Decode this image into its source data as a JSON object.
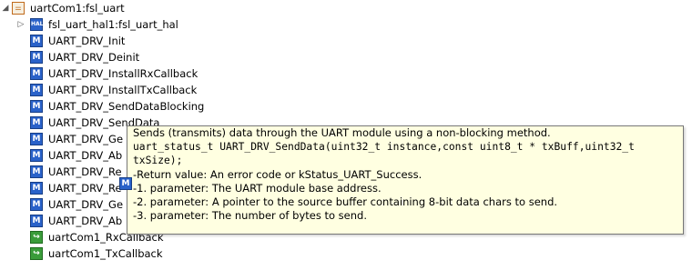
{
  "tree": {
    "root": {
      "label": "uartCom1:fsl_uart",
      "icon": "component-icon",
      "expanded": true
    },
    "hal": {
      "label": "fsl_uart_hal1:fsl_uart_hal",
      "icon": "hal-icon",
      "expanded": false
    },
    "methods": [
      "UART_DRV_Init",
      "UART_DRV_Deinit",
      "UART_DRV_InstallRxCallback",
      "UART_DRV_InstallTxCallback",
      "UART_DRV_SendDataBlocking",
      "UART_DRV_SendData",
      "UART_DRV_Ge",
      "UART_DRV_Ab",
      "UART_DRV_Re",
      "UART_DRV_Re",
      "UART_DRV_Ge",
      "UART_DRV_Ab"
    ],
    "callbacks": [
      "uartCom1_RxCallback",
      "uartCom1_TxCallback"
    ]
  },
  "tooltip": {
    "description": "Sends (transmits) data through the UART module using a non-blocking method.",
    "signature_line1": "uart_status_t UART_DRV_SendData(uint32_t instance,const uint8_t * txBuff,uint32_t",
    "signature_line2": "txSize);",
    "return_value": "-Return value: An error code or kStatus_UART_Success.",
    "param1": "-1. parameter: The UART module base address.",
    "param2": "-2. parameter: A pointer to the source buffer containing 8-bit data chars to send.",
    "param3": "-3. parameter: The number of bytes to send.",
    "icon": "method-icon"
  },
  "colors": {
    "method_icon": "#2a62c9",
    "callback_icon": "#3a9c3a",
    "component_icon": "#c06a1c",
    "tooltip_bg": "#ffffe1"
  }
}
